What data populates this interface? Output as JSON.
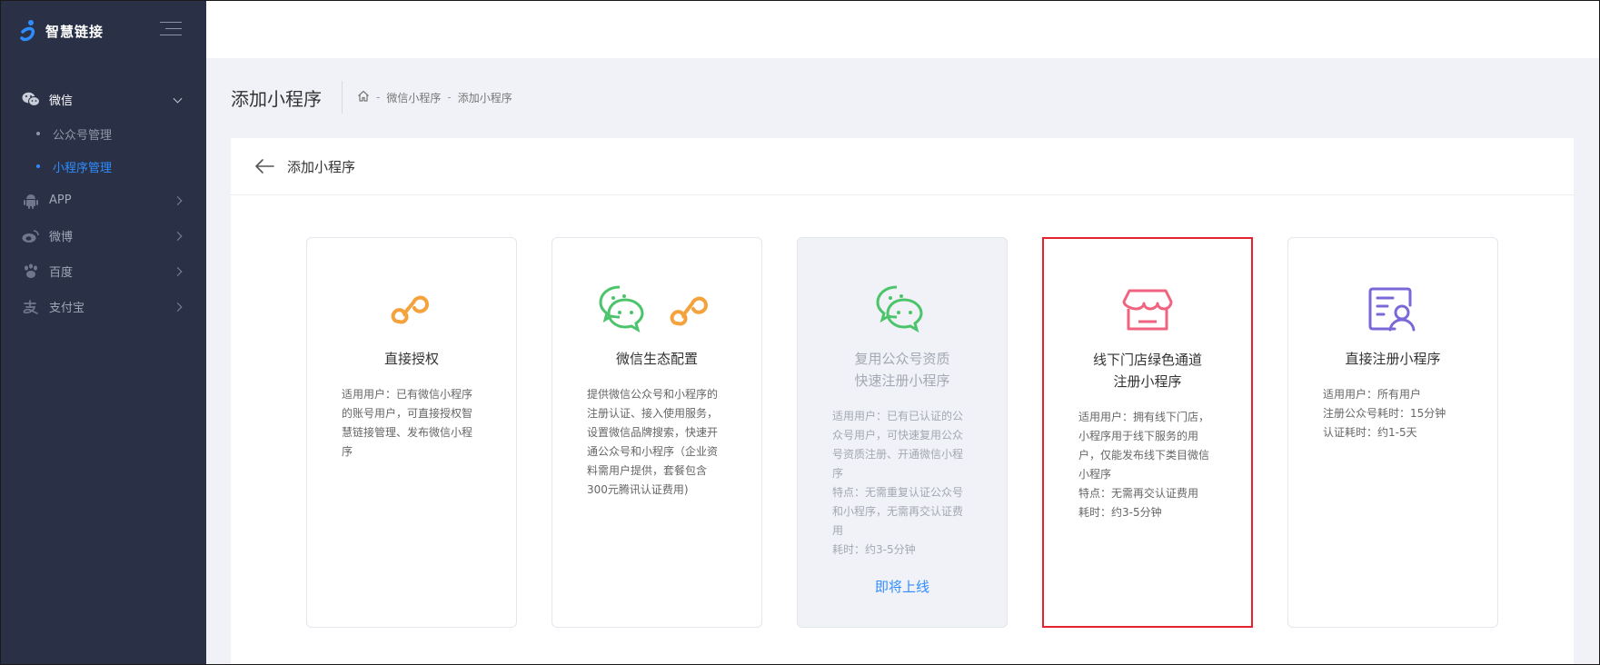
{
  "brand": {
    "name": "智慧链接"
  },
  "sidebar": {
    "items": [
      {
        "label": "微信",
        "icon": "wechat-icon",
        "open": true,
        "children": [
          {
            "label": "公众号管理",
            "active": false
          },
          {
            "label": "小程序管理",
            "active": true
          }
        ]
      },
      {
        "label": "APP",
        "icon": "android-icon"
      },
      {
        "label": "微博",
        "icon": "weibo-icon"
      },
      {
        "label": "百度",
        "icon": "baidu-paw-icon"
      },
      {
        "label": "支付宝",
        "icon": "alipay-icon"
      }
    ]
  },
  "page": {
    "title": "添加小程序",
    "breadcrumb": [
      "微信小程序",
      "添加小程序"
    ]
  },
  "panel": {
    "title": "添加小程序"
  },
  "cards": [
    {
      "title": "直接授权",
      "desc": [
        "适用用户：已有微信小程序",
        "的账号用户，可直接授权智",
        "慧链接管理、发布微信小程",
        "序"
      ]
    },
    {
      "title": "微信生态配置",
      "desc": [
        "提供微信公众号和小程序的",
        "注册认证、接入使用服务，",
        "设置微信品牌搜索，快速开",
        "通公众号和小程序（企业资",
        "料需用户提供，套餐包含",
        "300元腾讯认证费用)"
      ]
    },
    {
      "title_lines": [
        "复用公众号资质",
        "快速注册小程序"
      ],
      "desc": [
        "适用用户：已有已认证的公",
        "众号用户，可快速复用公众",
        "号资质注册、开通微信小程",
        "序",
        "特点：无需重复认证公众号",
        "和小程序，无需再交认证费",
        "用",
        "耗时：约3-5分钟"
      ],
      "link": "即将上线"
    },
    {
      "title_lines": [
        "线下门店绿色通道",
        "注册小程序"
      ],
      "desc": [
        "适用用户：拥有线下门店，",
        "小程序用于线下服务的用",
        "户，仅能发布线下类目微信",
        "小程序",
        "特点：无需再交认证费用",
        "耗时：约3-5分钟"
      ]
    },
    {
      "title": "直接注册小程序",
      "desc": [
        "适用用户：所有用户",
        "注册公众号耗时：15分钟",
        "认证耗时：约1-5天"
      ]
    }
  ],
  "colors": {
    "accent": "#2f8cff",
    "orange": "#f4a23c",
    "green": "#4cc46b",
    "pink": "#f0637e",
    "purple": "#7a68d8",
    "highlight": "#e8212a"
  }
}
